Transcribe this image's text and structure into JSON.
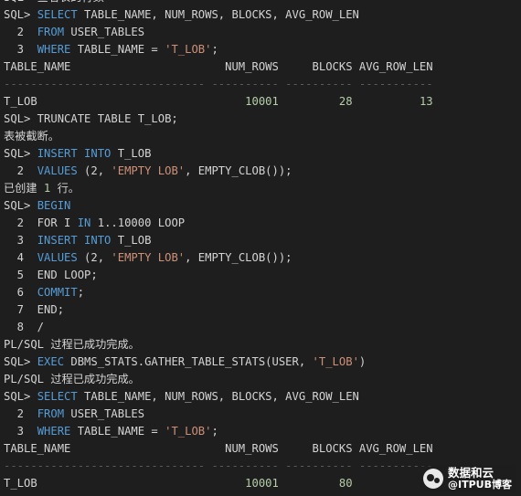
{
  "colors": {
    "background": "#1e1e1e",
    "text": "#d4d4d4",
    "keyword": "#569cd6",
    "string": "#ce9178",
    "number": "#b5cea8",
    "separator": "#5a5a5a"
  },
  "lines": [
    [
      {
        "t": "SQL> 查看表的行数"
      }
    ],
    [
      {
        "t": "SQL> "
      },
      {
        "t": "SELECT",
        "c": "kw"
      },
      {
        "t": " TABLE_NAME, NUM_ROWS, BLOCKS, AVG_ROW_LEN"
      }
    ],
    [
      {
        "t": "  2  "
      },
      {
        "t": "FROM",
        "c": "kw"
      },
      {
        "t": " USER_TABLES"
      }
    ],
    [
      {
        "t": "  3  "
      },
      {
        "t": "WHERE",
        "c": "kw"
      },
      {
        "t": " TABLE_NAME = "
      },
      {
        "t": "'T_LOB'",
        "c": "str"
      },
      {
        "t": ";"
      }
    ],
    [
      {
        "t": "TABLE_NAME                       NUM_ROWS     BLOCKS AVG_ROW_LEN"
      }
    ],
    [
      {
        "t": "------------------------------ ---------- ---------- -----------",
        "c": "sep"
      }
    ],
    [
      {
        "t": "T_LOB                               "
      },
      {
        "t": "10001",
        "c": "num"
      },
      {
        "t": "         "
      },
      {
        "t": "28",
        "c": "num"
      },
      {
        "t": "          "
      },
      {
        "t": "13",
        "c": "num"
      }
    ],
    [
      {
        "t": "SQL> TRUNCATE TABLE T_LOB;"
      }
    ],
    [
      {
        "t": "表被截断。"
      }
    ],
    [
      {
        "t": "SQL> "
      },
      {
        "t": "INSERT INTO",
        "c": "kw"
      },
      {
        "t": " T_LOB"
      }
    ],
    [
      {
        "t": "  2  "
      },
      {
        "t": "VALUES",
        "c": "kw"
      },
      {
        "t": " (2, "
      },
      {
        "t": "'EMPTY LOB'",
        "c": "str"
      },
      {
        "t": ", EMPTY_CLOB());"
      }
    ],
    [
      {
        "t": "已创建 "
      },
      {
        "t": "1",
        "c": "num"
      },
      {
        "t": " 行。"
      }
    ],
    [
      {
        "t": "SQL> "
      },
      {
        "t": "BEGIN",
        "c": "kw"
      }
    ],
    [
      {
        "t": "  2  FOR I "
      },
      {
        "t": "IN",
        "c": "kw"
      },
      {
        "t": " 1..10000 LOOP"
      }
    ],
    [
      {
        "t": "  3  "
      },
      {
        "t": "INSERT INTO",
        "c": "kw"
      },
      {
        "t": " T_LOB"
      }
    ],
    [
      {
        "t": "  4  "
      },
      {
        "t": "VALUES",
        "c": "kw"
      },
      {
        "t": " (2, "
      },
      {
        "t": "'EMPTY LOB'",
        "c": "str"
      },
      {
        "t": ", EMPTY_CLOB());"
      }
    ],
    [
      {
        "t": "  5  END LOOP;"
      }
    ],
    [
      {
        "t": "  6  "
      },
      {
        "t": "COMMIT",
        "c": "kw"
      },
      {
        "t": ";"
      }
    ],
    [
      {
        "t": "  7  END;"
      }
    ],
    [
      {
        "t": "  8  /"
      }
    ],
    [
      {
        "t": "PL/SQL 过程已成功完成。"
      }
    ],
    [
      {
        "t": "SQL> "
      },
      {
        "t": "EXEC",
        "c": "kw"
      },
      {
        "t": " DBMS_STATS.GATHER_TABLE_STATS(USER, "
      },
      {
        "t": "'T_LOB'",
        "c": "str"
      },
      {
        "t": ")"
      }
    ],
    [
      {
        "t": "PL/SQL 过程已成功完成。"
      }
    ],
    [
      {
        "t": "SQL> "
      },
      {
        "t": "SELECT",
        "c": "kw"
      },
      {
        "t": " TABLE_NAME, NUM_ROWS, BLOCKS, AVG_ROW_LEN"
      }
    ],
    [
      {
        "t": "  2  "
      },
      {
        "t": "FROM",
        "c": "kw"
      },
      {
        "t": " USER_TABLES"
      }
    ],
    [
      {
        "t": "  3  "
      },
      {
        "t": "WHERE",
        "c": "kw"
      },
      {
        "t": " TABLE_NAME = "
      },
      {
        "t": "'T_LOB'",
        "c": "str"
      },
      {
        "t": ";"
      }
    ],
    [
      {
        "t": "TABLE_NAME                       NUM_ROWS     BLOCKS AVG_ROW_LEN"
      }
    ],
    [
      {
        "t": "------------------------------ ---------- ---------- -----------",
        "c": "sep"
      }
    ],
    [
      {
        "t": "T_LOB                               "
      },
      {
        "t": "10001",
        "c": "num"
      },
      {
        "t": "         "
      },
      {
        "t": "80",
        "c": "num"
      }
    ]
  ],
  "watermark": {
    "logo_icon": "wechat-logo-icon",
    "title": "数据和云",
    "subtitle": "@ITPUB博客"
  }
}
